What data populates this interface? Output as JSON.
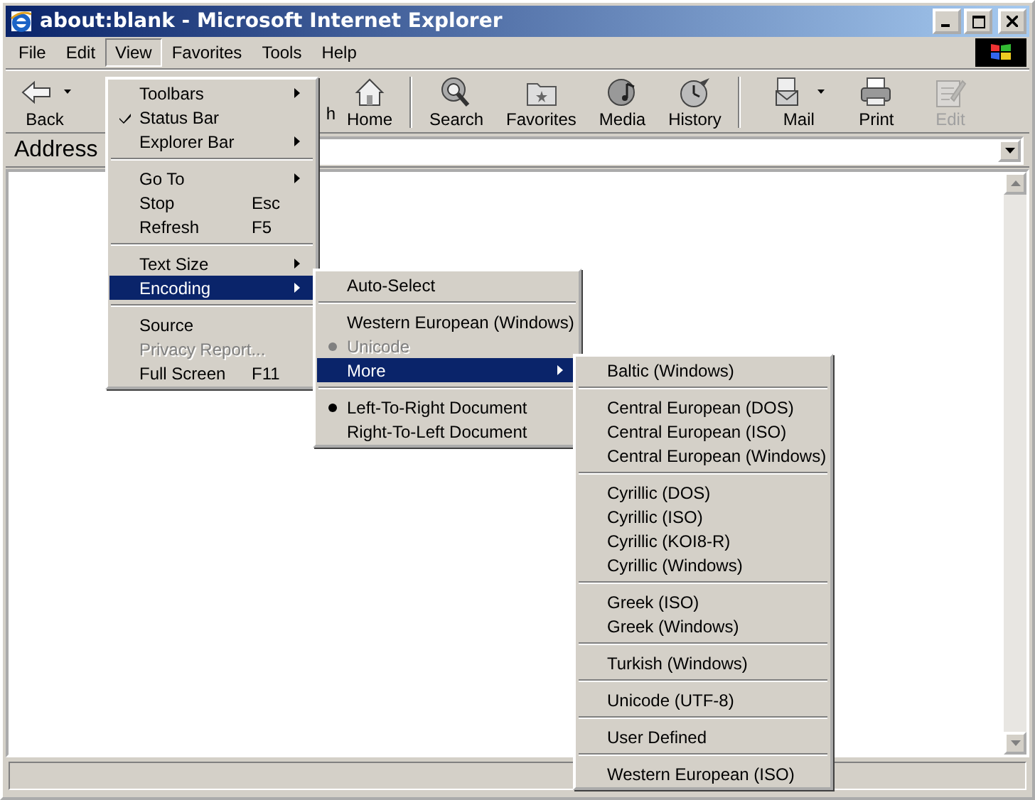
{
  "window": {
    "title": "about:blank - Microsoft Internet Explorer"
  },
  "menu_bar": [
    {
      "label": "File",
      "selected": false
    },
    {
      "label": "Edit",
      "selected": false
    },
    {
      "label": "View",
      "selected": true
    },
    {
      "label": "Favorites",
      "selected": false
    },
    {
      "label": "Tools",
      "selected": false
    },
    {
      "label": "Help",
      "selected": false
    }
  ],
  "toolbar": [
    {
      "kind": "button",
      "label": "Back",
      "dropdown": true,
      "disabled": false
    },
    {
      "kind": "partial",
      "label": "h"
    },
    {
      "kind": "button",
      "label": "Home",
      "dropdown": false,
      "disabled": false
    },
    {
      "kind": "separator"
    },
    {
      "kind": "button",
      "label": "Search",
      "dropdown": false,
      "disabled": false
    },
    {
      "kind": "button",
      "label": "Favorites",
      "dropdown": false,
      "disabled": false
    },
    {
      "kind": "button",
      "label": "Media",
      "dropdown": false,
      "disabled": false
    },
    {
      "kind": "button",
      "label": "History",
      "dropdown": false,
      "disabled": false
    },
    {
      "kind": "separator"
    },
    {
      "kind": "button",
      "label": "Mail",
      "dropdown": true,
      "disabled": false
    },
    {
      "kind": "button",
      "label": "Print",
      "dropdown": false,
      "disabled": false
    },
    {
      "kind": "button",
      "label": "Edit",
      "dropdown": false,
      "disabled": true
    }
  ],
  "address_bar": {
    "label": "Address"
  },
  "view_menu": {
    "items": [
      {
        "kind": "item",
        "label": "Toolbars",
        "submenu": true,
        "selected": false,
        "disabled": false
      },
      {
        "kind": "check",
        "label": "Status Bar",
        "checked": true,
        "submenu": false,
        "selected": false,
        "disabled": false
      },
      {
        "kind": "item",
        "label": "Explorer Bar",
        "submenu": true,
        "selected": false,
        "disabled": false
      },
      {
        "kind": "separator"
      },
      {
        "kind": "item",
        "label": "Go To",
        "submenu": true,
        "selected": false,
        "disabled": false
      },
      {
        "kind": "item",
        "label": "Stop",
        "shortcut": "Esc",
        "submenu": false,
        "selected": false,
        "disabled": false
      },
      {
        "kind": "item",
        "label": "Refresh",
        "shortcut": "F5",
        "submenu": false,
        "selected": false,
        "disabled": false
      },
      {
        "kind": "separator"
      },
      {
        "kind": "item",
        "label": "Text Size",
        "submenu": true,
        "selected": false,
        "disabled": false
      },
      {
        "kind": "item",
        "label": "Encoding",
        "submenu": true,
        "selected": true,
        "disabled": false
      },
      {
        "kind": "separator"
      },
      {
        "kind": "item",
        "label": "Source",
        "submenu": false,
        "selected": false,
        "disabled": false
      },
      {
        "kind": "item",
        "label": "Privacy Report...",
        "submenu": false,
        "selected": false,
        "disabled": true
      },
      {
        "kind": "item",
        "label": "Full Screen",
        "shortcut": "F11",
        "submenu": false,
        "selected": false,
        "disabled": false
      }
    ]
  },
  "encoding_menu": {
    "items": [
      {
        "kind": "item",
        "label": "Auto-Select",
        "submenu": false,
        "selected": false,
        "disabled": false
      },
      {
        "kind": "separator"
      },
      {
        "kind": "radio",
        "label": "Western European (Windows)",
        "checked": false,
        "submenu": false,
        "selected": false,
        "disabled": false
      },
      {
        "kind": "radio",
        "label": "Unicode",
        "checked": true,
        "submenu": false,
        "selected": false,
        "disabled": true
      },
      {
        "kind": "item",
        "label": "More",
        "submenu": true,
        "selected": true,
        "disabled": false
      },
      {
        "kind": "separator"
      },
      {
        "kind": "radio",
        "label": "Left-To-Right Document",
        "checked": true,
        "submenu": false,
        "selected": false,
        "disabled": false
      },
      {
        "kind": "radio",
        "label": "Right-To-Left Document",
        "checked": false,
        "submenu": false,
        "selected": false,
        "disabled": false
      }
    ]
  },
  "more_menu": {
    "items": [
      {
        "kind": "item",
        "label": "Baltic (Windows)",
        "submenu": false,
        "selected": false,
        "disabled": false
      },
      {
        "kind": "separator"
      },
      {
        "kind": "item",
        "label": "Central European (DOS)",
        "submenu": false,
        "selected": false,
        "disabled": false
      },
      {
        "kind": "item",
        "label": "Central European (ISO)",
        "submenu": false,
        "selected": false,
        "disabled": false
      },
      {
        "kind": "item",
        "label": "Central European (Windows)",
        "submenu": false,
        "selected": false,
        "disabled": false
      },
      {
        "kind": "separator"
      },
      {
        "kind": "item",
        "label": "Cyrillic (DOS)",
        "submenu": false,
        "selected": false,
        "disabled": false
      },
      {
        "kind": "item",
        "label": "Cyrillic (ISO)",
        "submenu": false,
        "selected": false,
        "disabled": false
      },
      {
        "kind": "item",
        "label": "Cyrillic (KOI8-R)",
        "submenu": false,
        "selected": false,
        "disabled": false
      },
      {
        "kind": "item",
        "label": "Cyrillic (Windows)",
        "submenu": false,
        "selected": false,
        "disabled": false
      },
      {
        "kind": "separator"
      },
      {
        "kind": "item",
        "label": "Greek (ISO)",
        "submenu": false,
        "selected": false,
        "disabled": false
      },
      {
        "kind": "item",
        "label": "Greek (Windows)",
        "submenu": false,
        "selected": false,
        "disabled": false
      },
      {
        "kind": "separator"
      },
      {
        "kind": "item",
        "label": "Turkish (Windows)",
        "submenu": false,
        "selected": false,
        "disabled": false
      },
      {
        "kind": "separator"
      },
      {
        "kind": "item",
        "label": "Unicode (UTF-8)",
        "submenu": false,
        "selected": false,
        "disabled": false
      },
      {
        "kind": "separator"
      },
      {
        "kind": "item",
        "label": "User Defined",
        "submenu": false,
        "selected": false,
        "disabled": false
      },
      {
        "kind": "separator"
      },
      {
        "kind": "item",
        "label": "Western European (ISO)",
        "submenu": false,
        "selected": false,
        "disabled": false
      }
    ]
  }
}
